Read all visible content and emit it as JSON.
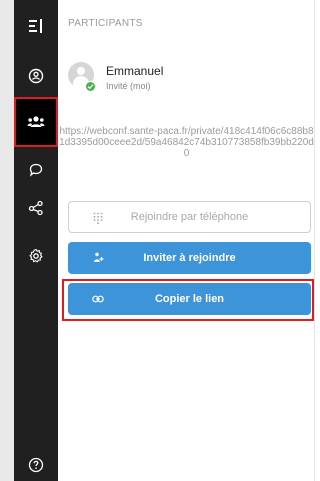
{
  "sidebar": {
    "items": [
      {
        "icon": "toggle-panel-icon"
      },
      {
        "icon": "profile-icon"
      },
      {
        "icon": "participants-icon",
        "active": true
      },
      {
        "icon": "chat-icon"
      },
      {
        "icon": "share-icon"
      },
      {
        "icon": "settings-icon"
      },
      {
        "icon": "help-icon"
      }
    ]
  },
  "panel": {
    "title": "PARTICIPANTS",
    "participant": {
      "name": "Emmanuel",
      "role": "Invité (moi)"
    },
    "link": "https://webconf.sante-paca.fr/private/418c414f06c6c88b81d3395d00ceee2d/59a46842c74b310773858fb39bb220d0",
    "buttons": {
      "phone": "Rejoindre par téléphone",
      "invite": "Inviter à rejoindre",
      "copy": "Copier le lien"
    }
  },
  "colors": {
    "sidebar_bg": "#202020",
    "accent": "#3d94d8",
    "highlight": "#e11b22",
    "status_ok": "#4caf50"
  }
}
